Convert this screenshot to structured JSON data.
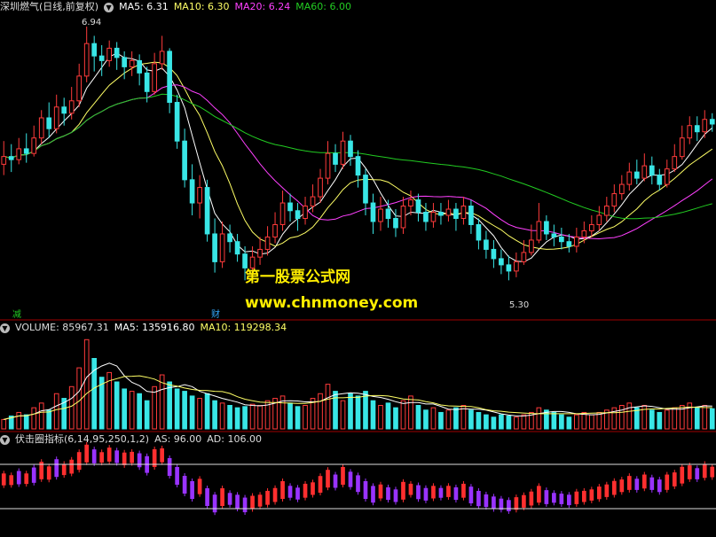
{
  "header_main": {
    "stock": "深圳燃气(日线,前复权)",
    "ma5": "MA5: 6.31",
    "ma10": "MA10: 6.30",
    "ma20": "MA20: 6.24",
    "ma60": "MA60: 6.00"
  },
  "header_volume": {
    "volume": "VOLUME: 85967.31",
    "ma5": "MA5: 135916.80",
    "ma10": "MA10: 119298.34"
  },
  "header_indicator": {
    "name": "伏击圈指标(6,14,95,250,1,2)",
    "as": "AS: 96.00",
    "ad": "AD: 106.00"
  },
  "watermark": {
    "line1": "第一股票公式网",
    "line2": "www.chnmoney.com"
  },
  "markers": {
    "high_label": "6.94",
    "low_label": "5.30",
    "tag_left": "减",
    "tag_mid": "财"
  },
  "colors": {
    "up": "#ff3b3b",
    "down": "#39e6e6",
    "ma5": "#ffffff",
    "ma10": "#ffff66",
    "ma20": "#ff40ff",
    "ma60": "#22cc22",
    "ind_up": "#ff2f2f",
    "ind_down": "#9933ff"
  },
  "chart_data": {
    "type": "candlestick",
    "price_range": [
      5.05,
      7.02
    ],
    "candles": [
      [
        6.05,
        6.1,
        6.2,
        5.98
      ],
      [
        6.1,
        6.08,
        6.18,
        6.0
      ],
      [
        6.08,
        6.15,
        6.22,
        6.05
      ],
      [
        6.15,
        6.12,
        6.25,
        6.06
      ],
      [
        6.12,
        6.22,
        6.3,
        6.1
      ],
      [
        6.22,
        6.35,
        6.4,
        6.18
      ],
      [
        6.35,
        6.28,
        6.45,
        6.22
      ],
      [
        6.28,
        6.42,
        6.5,
        6.25
      ],
      [
        6.42,
        6.38,
        6.48,
        6.3
      ],
      [
        6.38,
        6.46,
        6.55,
        6.34
      ],
      [
        6.46,
        6.62,
        6.7,
        6.42
      ],
      [
        6.62,
        6.83,
        6.94,
        6.58
      ],
      [
        6.83,
        6.75,
        6.88,
        6.65
      ],
      [
        6.75,
        6.72,
        6.82,
        6.62
      ],
      [
        6.72,
        6.8,
        6.85,
        6.68
      ],
      [
        6.8,
        6.74,
        6.84,
        6.66
      ],
      [
        6.74,
        6.68,
        6.78,
        6.6
      ],
      [
        6.68,
        6.72,
        6.78,
        6.62
      ],
      [
        6.72,
        6.64,
        6.76,
        6.56
      ],
      [
        6.64,
        6.52,
        6.68,
        6.45
      ],
      [
        6.52,
        6.7,
        6.77,
        6.5
      ],
      [
        6.7,
        6.78,
        6.88,
        6.66
      ],
      [
        6.78,
        6.45,
        6.8,
        6.38
      ],
      [
        6.45,
        6.2,
        6.5,
        6.15
      ],
      [
        6.2,
        5.95,
        6.28,
        5.9
      ],
      [
        5.95,
        5.8,
        6.05,
        5.72
      ],
      [
        5.8,
        5.9,
        5.98,
        5.7
      ],
      [
        5.9,
        5.6,
        5.95,
        5.55
      ],
      [
        5.6,
        5.42,
        5.7,
        5.35
      ],
      [
        5.42,
        5.6,
        5.68,
        5.38
      ],
      [
        5.6,
        5.55,
        5.66,
        5.48
      ],
      [
        5.55,
        5.47,
        5.6,
        5.42
      ],
      [
        5.47,
        5.38,
        5.52,
        5.3
      ],
      [
        5.38,
        5.45,
        5.52,
        5.34
      ],
      [
        5.45,
        5.5,
        5.58,
        5.4
      ],
      [
        5.5,
        5.58,
        5.65,
        5.46
      ],
      [
        5.58,
        5.66,
        5.74,
        5.54
      ],
      [
        5.66,
        5.8,
        5.88,
        5.62
      ],
      [
        5.8,
        5.75,
        5.86,
        5.68
      ],
      [
        5.75,
        5.7,
        5.8,
        5.62
      ],
      [
        5.7,
        5.78,
        5.84,
        5.66
      ],
      [
        5.78,
        5.84,
        5.92,
        5.74
      ],
      [
        5.84,
        5.96,
        6.02,
        5.8
      ],
      [
        5.96,
        6.12,
        6.2,
        5.92
      ],
      [
        6.12,
        6.05,
        6.18,
        6.0
      ],
      [
        6.05,
        6.2,
        6.26,
        6.02
      ],
      [
        6.2,
        6.1,
        6.24,
        6.04
      ],
      [
        6.1,
        5.98,
        6.14,
        5.9
      ],
      [
        5.98,
        5.8,
        6.02,
        5.72
      ],
      [
        5.8,
        5.68,
        5.86,
        5.6
      ],
      [
        5.68,
        5.76,
        5.84,
        5.62
      ],
      [
        5.76,
        5.7,
        5.82,
        5.64
      ],
      [
        5.7,
        5.64,
        5.76,
        5.58
      ],
      [
        5.64,
        5.78,
        5.84,
        5.6
      ],
      [
        5.78,
        5.82,
        5.88,
        5.72
      ],
      [
        5.82,
        5.74,
        5.86,
        5.68
      ],
      [
        5.74,
        5.68,
        5.8,
        5.62
      ],
      [
        5.68,
        5.74,
        5.8,
        5.64
      ],
      [
        5.74,
        5.72,
        5.8,
        5.66
      ],
      [
        5.72,
        5.76,
        5.82,
        5.68
      ],
      [
        5.76,
        5.7,
        5.8,
        5.62
      ],
      [
        5.7,
        5.78,
        5.84,
        5.66
      ],
      [
        5.78,
        5.66,
        5.82,
        5.6
      ],
      [
        5.66,
        5.56,
        5.7,
        5.5
      ],
      [
        5.56,
        5.5,
        5.62,
        5.44
      ],
      [
        5.5,
        5.44,
        5.56,
        5.38
      ],
      [
        5.44,
        5.4,
        5.5,
        5.34
      ],
      [
        5.4,
        5.36,
        5.46,
        5.3
      ],
      [
        5.36,
        5.42,
        5.48,
        5.32
      ],
      [
        5.42,
        5.48,
        5.56,
        5.4
      ],
      [
        5.48,
        5.56,
        5.66,
        5.46
      ],
      [
        5.56,
        5.68,
        5.8,
        5.54
      ],
      [
        5.68,
        5.6,
        5.72,
        5.56
      ],
      [
        5.6,
        5.58,
        5.66,
        5.52
      ],
      [
        5.58,
        5.55,
        5.64,
        5.5
      ],
      [
        5.55,
        5.52,
        5.6,
        5.48
      ],
      [
        5.52,
        5.58,
        5.64,
        5.48
      ],
      [
        5.58,
        5.62,
        5.68,
        5.54
      ],
      [
        5.62,
        5.66,
        5.72,
        5.58
      ],
      [
        5.66,
        5.72,
        5.78,
        5.62
      ],
      [
        5.72,
        5.78,
        5.84,
        5.68
      ],
      [
        5.78,
        5.86,
        5.92,
        5.74
      ],
      [
        5.86,
        5.92,
        5.98,
        5.82
      ],
      [
        5.92,
        6.0,
        6.06,
        5.88
      ],
      [
        6.0,
        5.96,
        6.08,
        5.92
      ],
      [
        5.96,
        6.04,
        6.12,
        5.94
      ],
      [
        6.04,
        5.98,
        6.1,
        5.92
      ],
      [
        5.98,
        5.92,
        6.02,
        5.88
      ],
      [
        5.92,
        6.02,
        6.08,
        5.9
      ],
      [
        6.02,
        6.1,
        6.18,
        6.0
      ],
      [
        6.1,
        6.22,
        6.3,
        6.08
      ],
      [
        6.22,
        6.3,
        6.36,
        6.18
      ],
      [
        6.3,
        6.26,
        6.36,
        6.2
      ],
      [
        6.26,
        6.34,
        6.4,
        6.22
      ],
      [
        6.34,
        6.31,
        6.38,
        6.26
      ]
    ],
    "volume_range": [
      0,
      400000
    ],
    "volume": [
      40000,
      55000,
      70000,
      60000,
      90000,
      110000,
      80000,
      150000,
      130000,
      180000,
      260000,
      380000,
      300000,
      220000,
      240000,
      200000,
      170000,
      160000,
      150000,
      120000,
      180000,
      230000,
      200000,
      170000,
      160000,
      140000,
      130000,
      150000,
      120000,
      110000,
      100000,
      90000,
      95000,
      105000,
      100000,
      120000,
      130000,
      140000,
      110000,
      95000,
      100000,
      130000,
      150000,
      190000,
      160000,
      120000,
      150000,
      140000,
      160000,
      120000,
      100000,
      110000,
      90000,
      120000,
      140000,
      100000,
      80000,
      90000,
      70000,
      80000,
      90000,
      100000,
      80000,
      70000,
      60000,
      50000,
      60000,
      55000,
      50000,
      60000,
      70000,
      90000,
      80000,
      70000,
      60000,
      50000,
      60000,
      70000,
      60000,
      70000,
      80000,
      90000,
      100000,
      110000,
      90000,
      100000,
      80000,
      70000,
      80000,
      90000,
      100000,
      110000,
      90000,
      100000,
      85967
    ],
    "indicator": [
      1,
      1,
      -1,
      1,
      -1,
      1,
      1,
      -1,
      1,
      1,
      1,
      1,
      -1,
      1,
      1,
      -1,
      1,
      1,
      -1,
      -1,
      1,
      1,
      -1,
      -1,
      -1,
      -1,
      1,
      -1,
      -1,
      1,
      -1,
      -1,
      -1,
      1,
      1,
      1,
      1,
      1,
      -1,
      -1,
      1,
      1,
      1,
      1,
      -1,
      1,
      -1,
      -1,
      -1,
      -1,
      1,
      -1,
      -1,
      1,
      1,
      -1,
      -1,
      1,
      -1,
      1,
      -1,
      1,
      -1,
      -1,
      -1,
      -1,
      -1,
      -1,
      1,
      1,
      1,
      1,
      -1,
      -1,
      -1,
      -1,
      1,
      1,
      1,
      1,
      1,
      1,
      1,
      1,
      -1,
      1,
      -1,
      -1,
      1,
      1,
      1,
      1,
      -1,
      1,
      1
    ]
  }
}
